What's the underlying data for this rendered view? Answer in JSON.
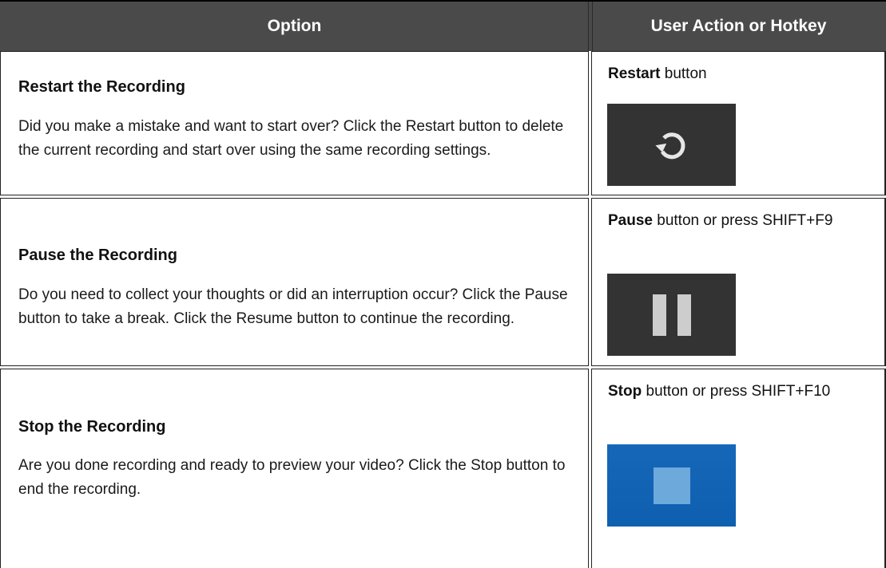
{
  "table": {
    "headers": {
      "option": "Option",
      "action": "User Action or Hotkey"
    },
    "rows": [
      {
        "title": "Restart the Recording",
        "description": "Did you make a mistake and want to start over? Click the Restart button to delete the current recording and start over using the same recording settings.",
        "action_bold": "Restart",
        "action_rest": " button",
        "button_icon": "restart-icon",
        "button_color": "#333333"
      },
      {
        "title": "Pause the Recording",
        "description": "Do you need to collect your thoughts or did an interruption occur? Click the Pause button to take a break. Click the Resume button to continue the recording.",
        "action_bold": "Pause",
        "action_rest": " button or press SHIFT+F9",
        "button_icon": "pause-icon",
        "button_color": "#333333"
      },
      {
        "title": "Stop the Recording",
        "description": "Are you done recording and ready to preview your video? Click the Stop button to end the recording.",
        "action_bold": "Stop",
        "action_rest": " button or press SHIFT+F10",
        "button_icon": "stop-icon",
        "button_color": "#1667b8"
      }
    ]
  }
}
